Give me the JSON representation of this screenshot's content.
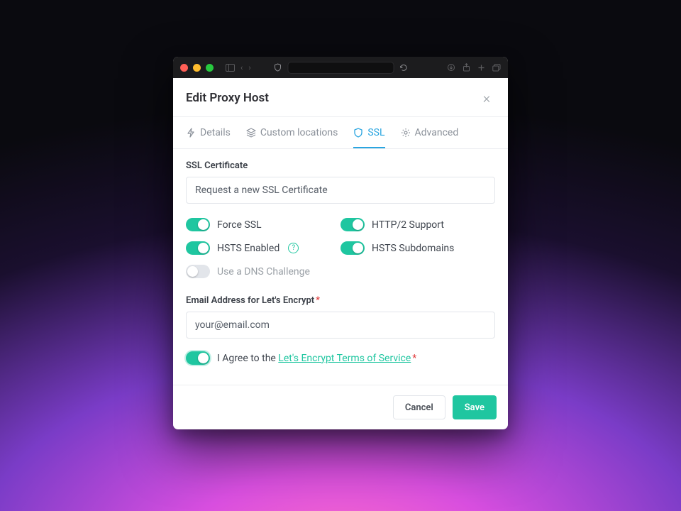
{
  "modal": {
    "title": "Edit Proxy Host"
  },
  "tabs": {
    "details": "Details",
    "custom_locations": "Custom locations",
    "ssl": "SSL",
    "advanced": "Advanced"
  },
  "ssl": {
    "cert_label": "SSL Certificate",
    "cert_value": "Request a new SSL Certificate",
    "force_ssl": "Force SSL",
    "http2": "HTTP/2 Support",
    "hsts": "HSTS Enabled",
    "hsts_sub": "HSTS Subdomains",
    "dns_challenge": "Use a DNS Challenge",
    "email_label": "Email Address for Let's Encrypt",
    "email_required": "*",
    "email_value": "your@email.com",
    "agree_prefix": "I Agree to the ",
    "agree_link": "Let's Encrypt Terms of Service",
    "agree_required": "*"
  },
  "footer": {
    "cancel": "Cancel",
    "save": "Save"
  },
  "toggle_state": {
    "force_ssl": true,
    "http2": true,
    "hsts": true,
    "hsts_sub": true,
    "dns": false,
    "agree": true
  },
  "colors": {
    "accent_teal": "#1fc6a0",
    "accent_blue": "#2aa5e0"
  }
}
